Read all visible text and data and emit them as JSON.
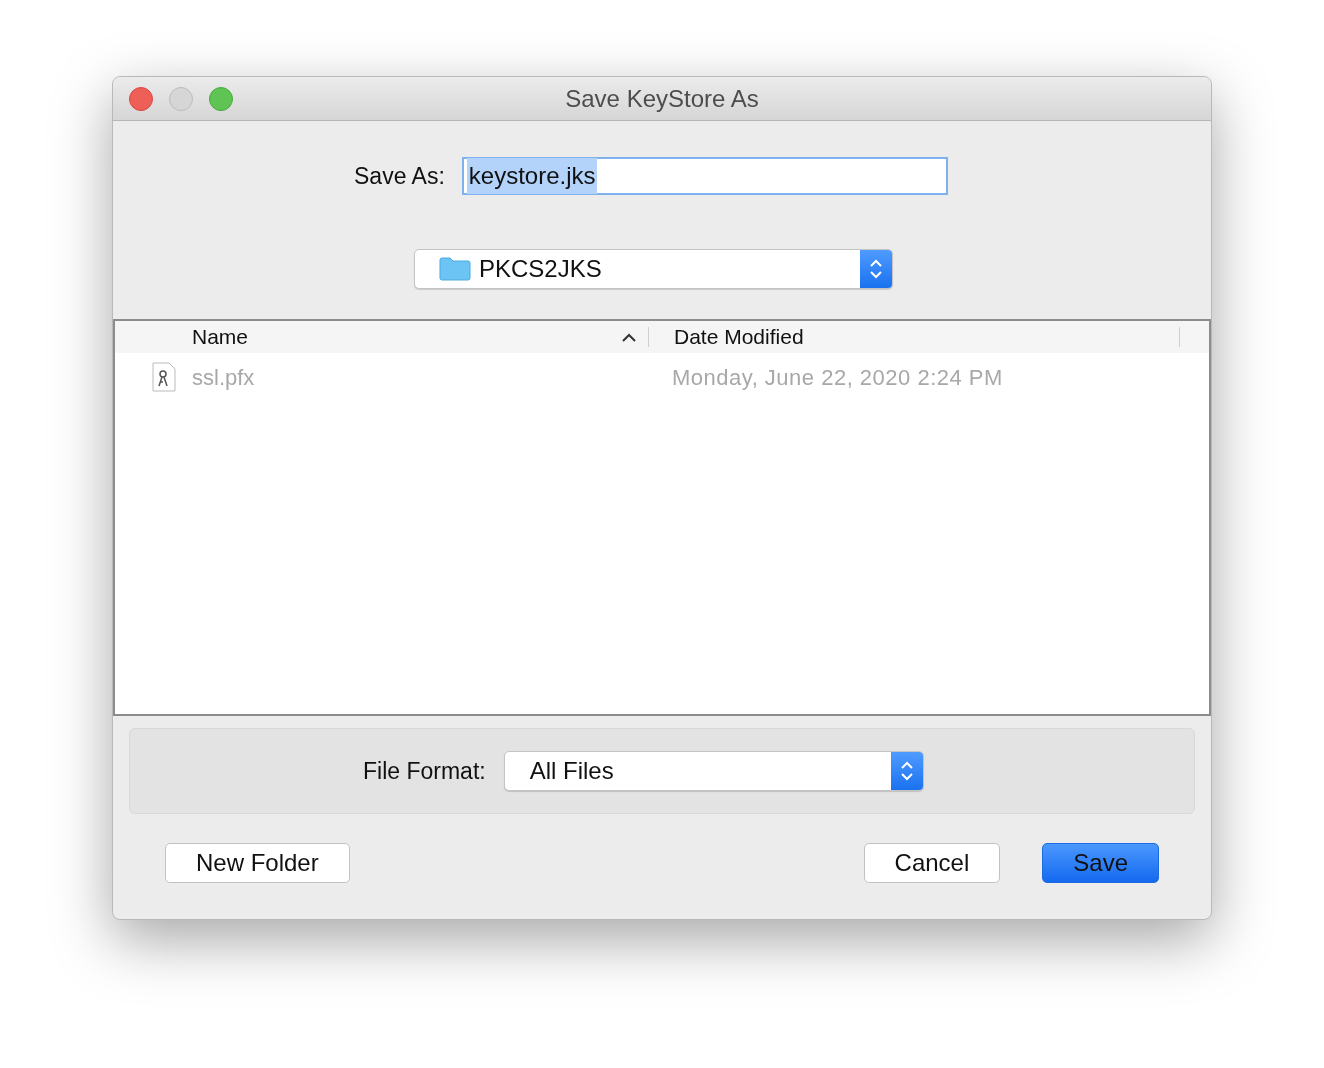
{
  "window": {
    "title": "Save KeyStore As"
  },
  "save_as": {
    "label": "Save As:",
    "value": "keystore.jks",
    "text_selected": true
  },
  "folder_popup": {
    "value": "PKCS2JKS"
  },
  "table": {
    "columns": [
      {
        "label": "Name",
        "sorted": true
      },
      {
        "label": "Date Modified",
        "sorted": false
      }
    ],
    "rows": [
      {
        "name": "ssl.pfx",
        "date": "Monday, June 22, 2020 2:24 PM",
        "disabled": true
      }
    ]
  },
  "file_format": {
    "label": "File Format:",
    "value": "All Files"
  },
  "buttons": [
    {
      "label": "New Folder",
      "kind": "default"
    },
    {
      "label": "Cancel",
      "kind": "default"
    },
    {
      "label": "Save",
      "kind": "primary"
    }
  ]
}
